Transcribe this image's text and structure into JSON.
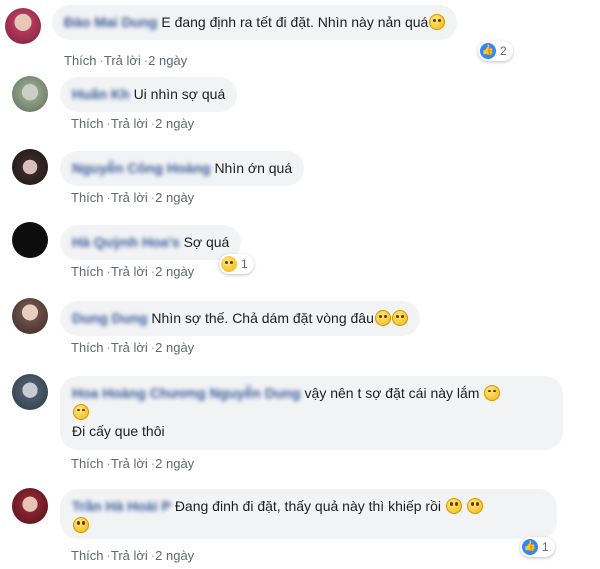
{
  "actions": {
    "like": "Thích",
    "reply": "Trả lời",
    "dot": "·"
  },
  "comments": [
    {
      "name": "Đào Mai Dung",
      "text": "E đang định ra tết đi đặt. Nhìn này nản quá",
      "emoji": "sad",
      "time": "2 ngày",
      "reaction_count": "2",
      "reaction_type": "like",
      "avatar_color": "#b33a5d"
    },
    {
      "name": "Huấn Kh",
      "text": "Ui nhìn sợ quá",
      "emoji": "",
      "time": "2 ngày",
      "avatar_color": "#8fa08a"
    },
    {
      "name": "Nguyễn Công Hoàng",
      "text": "Nhìn ớn quá",
      "emoji": "",
      "time": "2 ngày",
      "avatar_color": "#3a2a2a"
    },
    {
      "name": "Hà Quỳnh Hoa's",
      "text": "Sợ quá",
      "emoji": "",
      "time": "2 ngày",
      "reaction_count": "1",
      "reaction_type": "sad",
      "avatar_color": "#111111"
    },
    {
      "name": "Dung Dung",
      "text": "Nhìn sợ thế. Chả dám đặt vòng đâu",
      "emoji": "eyeroll",
      "time": "2 ngày",
      "avatar_color": "#6b5048"
    },
    {
      "name": "Hoa Hoàng Chương Nguyễn Dung",
      "text": "vậy nên t sợ đặt cái này lắm",
      "text2": "Đi cấy que thôi",
      "emoji": "laugh",
      "time": "2 ngày",
      "avatar_color": "#4c5b6b"
    },
    {
      "name": "Trần Hà Hoài P",
      "text": "Đang đinh đi đặt, thấy quả này thì khiếp rồi",
      "emoji": "grimace",
      "time": "2 ngày",
      "reaction_count": "1",
      "reaction_type": "like",
      "avatar_color": "#8a2430"
    }
  ]
}
